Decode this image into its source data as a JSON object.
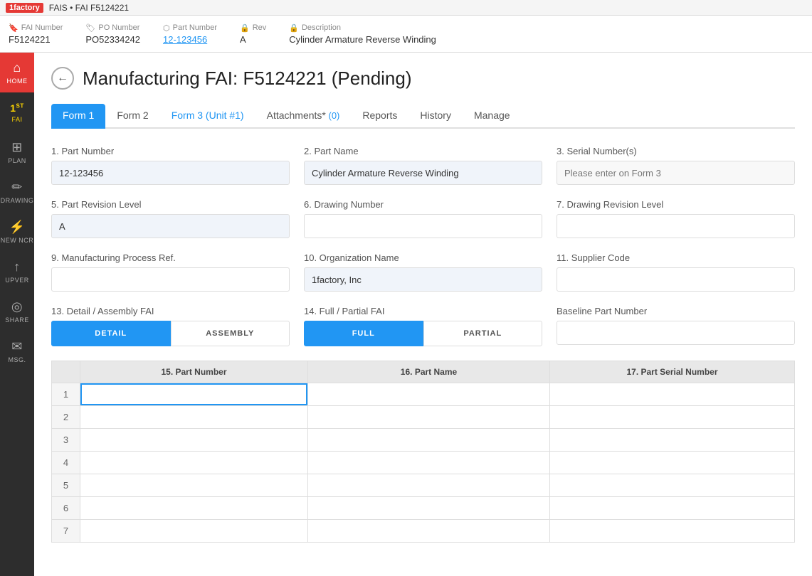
{
  "topbar": {
    "brand": "1factory",
    "breadcrumb": "FAIS • FAI F5124221"
  },
  "header": {
    "fai_number_label": "FAI Number",
    "fai_number_value": "F5124221",
    "po_number_label": "PO Number",
    "po_number_value": "PO52334242",
    "part_number_label": "Part Number",
    "part_number_value": "12-123456",
    "rev_label": "Rev",
    "rev_value": "A",
    "description_label": "Description",
    "description_value": "Cylinder Armature Reverse Winding"
  },
  "sidebar": {
    "items": [
      {
        "id": "home",
        "icon": "⌂",
        "label": "HOME",
        "active": false,
        "home": true
      },
      {
        "id": "fai",
        "icon": "1ˢᵗ",
        "label": "FAI",
        "active": true,
        "fai": true
      },
      {
        "id": "plan",
        "icon": "◫",
        "label": "PLAN",
        "active": false
      },
      {
        "id": "drawing",
        "icon": "✏",
        "label": "DRAWING",
        "active": false
      },
      {
        "id": "new-ncr",
        "icon": "⚡",
        "label": "NEW NCR",
        "active": false
      },
      {
        "id": "upver",
        "icon": "↑",
        "label": "UPVER",
        "active": false
      },
      {
        "id": "share",
        "icon": "◎",
        "label": "SHARE",
        "active": false
      },
      {
        "id": "msg",
        "icon": "✉",
        "label": "MSG.",
        "active": false
      }
    ]
  },
  "page": {
    "title": "Manufacturing FAI: F5124221 (Pending)"
  },
  "tabs": [
    {
      "id": "form1",
      "label": "Form 1",
      "active": true,
      "badge": ""
    },
    {
      "id": "form2",
      "label": "Form 2",
      "active": false,
      "badge": ""
    },
    {
      "id": "form3",
      "label": "Form 3 (Unit #1)",
      "active": false,
      "badge": "",
      "highlight": true
    },
    {
      "id": "attachments",
      "label": "Attachments*",
      "active": false,
      "badge": " (0)"
    },
    {
      "id": "reports",
      "label": "Reports",
      "active": false,
      "badge": ""
    },
    {
      "id": "history",
      "label": "History",
      "active": false,
      "badge": ""
    },
    {
      "id": "manage",
      "label": "Manage",
      "active": false,
      "badge": ""
    }
  ],
  "form": {
    "field1_label": "1. Part Number",
    "field1_value": "12-123456",
    "field2_label": "2. Part Name",
    "field2_value": "Cylinder Armature Reverse Winding",
    "field3_label": "3. Serial Number(s)",
    "field3_placeholder": "Please enter on Form 3",
    "field5_label": "5. Part Revision Level",
    "field5_value": "A",
    "field6_label": "6. Drawing Number",
    "field6_value": "",
    "field7_label": "7. Drawing Revision Level",
    "field7_value": "",
    "field9_label": "9. Manufacturing Process Ref.",
    "field9_value": "",
    "field10_label": "10. Organization Name",
    "field10_value": "1factory, Inc",
    "field11_label": "11. Supplier Code",
    "field11_value": "",
    "field13_label": "13. Detail / Assembly FAI",
    "toggle13_a": "DETAIL",
    "toggle13_b": "ASSEMBLY",
    "toggle13_active": "DETAIL",
    "field14_label": "14. Full / Partial FAI",
    "toggle14_a": "FULL",
    "toggle14_b": "PARTIAL",
    "toggle14_active": "FULL",
    "baseline_label": "Baseline Part Number",
    "baseline_value": ""
  },
  "table": {
    "col1_label": "15. Part Number",
    "col2_label": "16. Part Name",
    "col3_label": "17. Part Serial Number",
    "rows": [
      1,
      2,
      3,
      4,
      5,
      6,
      7
    ]
  }
}
